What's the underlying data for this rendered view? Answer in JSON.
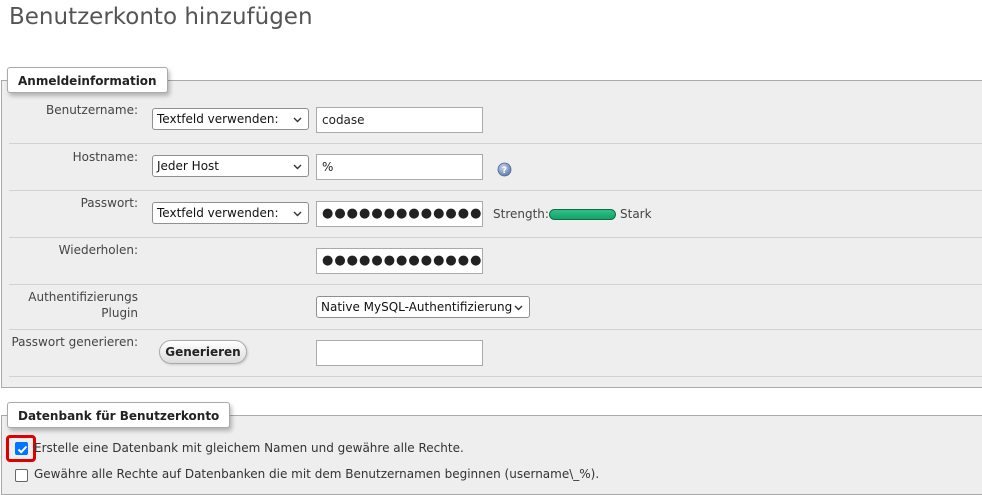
{
  "page": {
    "title": "Benutzerkonto hinzufügen"
  },
  "login": {
    "legend": "Anmeldeinformation",
    "username": {
      "label": "Benutzername:",
      "select_value": "Textfeld verwenden:",
      "value": "codase"
    },
    "hostname": {
      "label": "Hostname:",
      "select_value": "Jeder Host",
      "value": "%",
      "help_icon": "help-icon"
    },
    "password": {
      "label": "Passwort:",
      "select_value": "Textfeld verwenden:",
      "value": "●●●●●●●●●●●●●",
      "strength_label": "Strength:",
      "strength_value": "Stark",
      "strength_level": 1.0,
      "meter_color": "#1db37a"
    },
    "repeat": {
      "label": "Wiederholen:",
      "value": "●●●●●●●●●●●●●"
    },
    "auth_plugin": {
      "label_line1": "Authentifizierungs",
      "label_line2": "Plugin",
      "select_value": "Native MySQL-Authentifizierung"
    },
    "generate": {
      "label": "Passwort generieren:",
      "button_label": "Generieren",
      "value": ""
    }
  },
  "database": {
    "legend": "Datenbank für Benutzerkonto",
    "options": [
      {
        "label": "Erstelle eine Datenbank mit gleichem Namen und gewähre alle Rechte.",
        "checked": true
      },
      {
        "label": "Gewähre alle Rechte auf Datenbanken die mit dem Benutzernamen beginnen (username\\_%).",
        "checked": false
      }
    ]
  },
  "colors": {
    "fieldset_bg": "#eeeeee",
    "checkbox_accent": "#0075ff",
    "highlight": "#e00000"
  }
}
